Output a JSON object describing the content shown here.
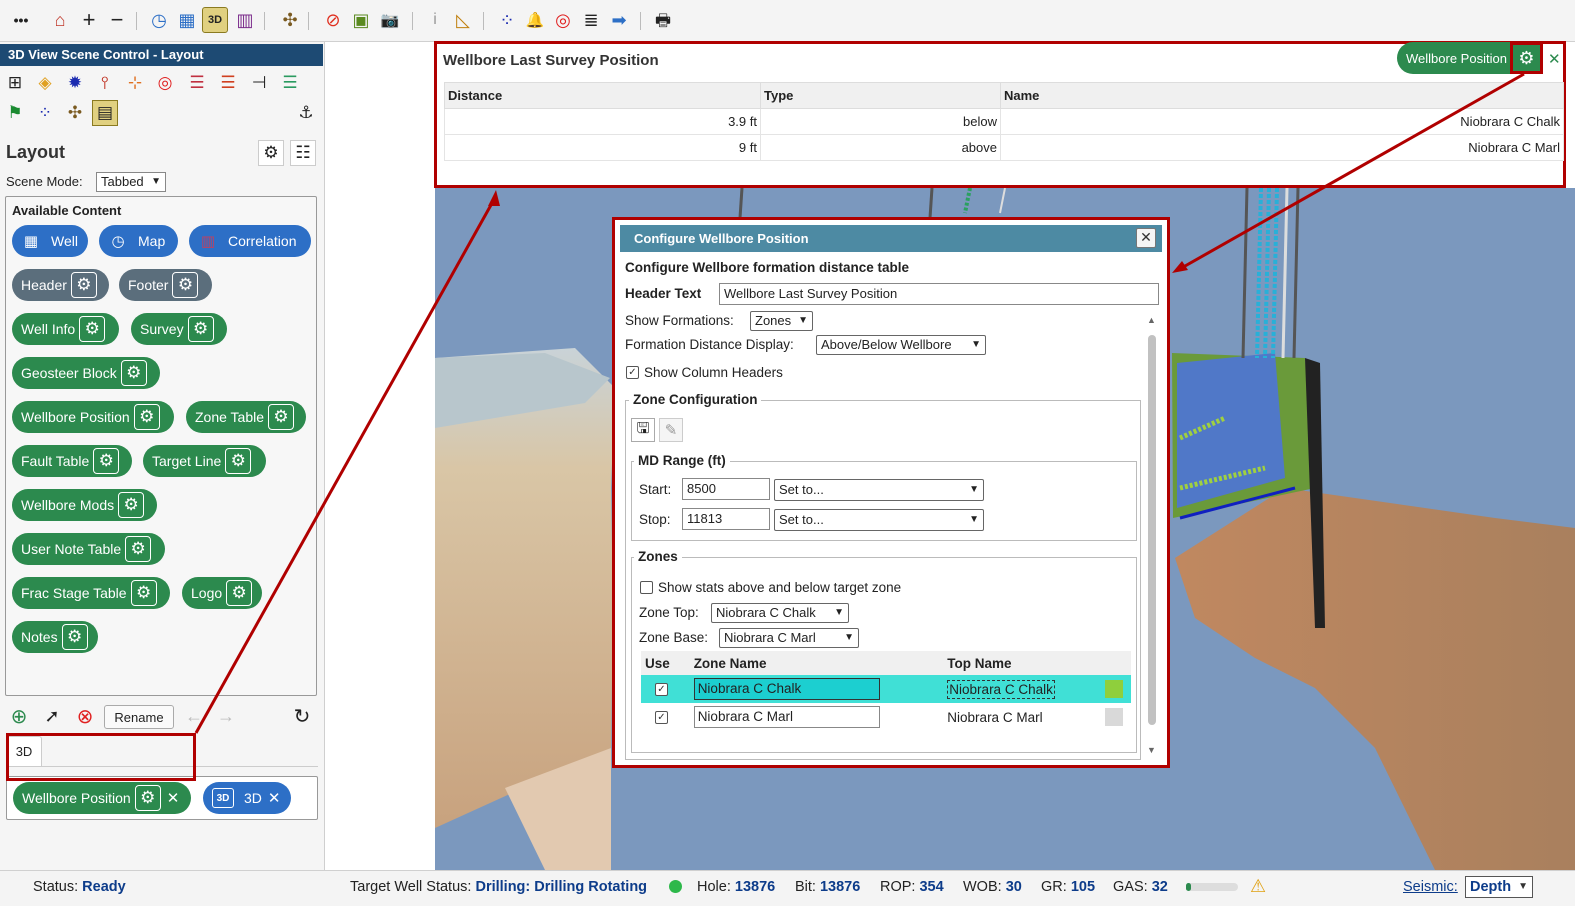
{
  "toolbar": {
    "icons": [
      "more-icon",
      "home-icon",
      "zoom-in-icon",
      "zoom-out-icon",
      "compass-icon",
      "grid-icon",
      "3d-view-icon",
      "correlation-icon",
      "fault-icon",
      "no-entry-icon",
      "cube-icon",
      "camera-icon",
      "info-icon",
      "ruler-icon",
      "points-icon",
      "bell-icon",
      "target-icon",
      "layers-icon",
      "arrow-right-icon",
      "print-icon"
    ],
    "glyphs": [
      "•••",
      "⌂",
      "+",
      "−",
      "◷",
      "▦",
      "3D",
      "▥",
      "✣",
      "⊘",
      "▣",
      "📷",
      "i",
      "◺",
      "⁘",
      "🔔",
      "◎",
      "≣",
      "➡",
      "🖶"
    ]
  },
  "left_panel": {
    "title": "3D View Scene Control - Layout",
    "layout_title": "Layout",
    "scene_mode_label": "Scene Mode:",
    "scene_mode_value": "Tabbed",
    "available_title": "Available Content",
    "chips": {
      "well": "Well",
      "map": "Map",
      "correlation": "Correlation",
      "header": "Header",
      "footer": "Footer",
      "well_info": "Well Info",
      "survey": "Survey",
      "geosteer_block": "Geosteer Block",
      "wellbore_position": "Wellbore Position",
      "zone_table": "Zone Table",
      "fault_table": "Fault Table",
      "target_line": "Target Line",
      "wellbore_mods": "Wellbore Mods",
      "user_note_table": "User Note Table",
      "frac_stage_table": "Frac Stage Table",
      "logo": "Logo",
      "notes": "Notes"
    },
    "rename_label": "Rename",
    "tab_label": "3D",
    "active": {
      "wellbore_position": "Wellbore Position",
      "threed": "3D",
      "threed_icon": "3D"
    }
  },
  "survey_panel": {
    "title": "Wellbore Last Survey Position",
    "columns": [
      "Distance",
      "Type",
      "Name"
    ],
    "rows": [
      {
        "distance": "3.9 ft",
        "type": "below",
        "name": "Niobrara C Chalk"
      },
      {
        "distance": "9 ft",
        "type": "above",
        "name": "Niobrara C Marl"
      }
    ],
    "badge_label": "Wellbore Position"
  },
  "dialog": {
    "title": "Configure Wellbore Position",
    "subtitle": "Configure Wellbore formation distance table",
    "header_text_label": "Header Text",
    "header_text_value": "Wellbore Last Survey Position",
    "show_formations_label": "Show Formations:",
    "show_formations_value": "Zones",
    "formation_distance_label": "Formation Distance Display:",
    "formation_distance_value": "Above/Below Wellbore",
    "show_column_headers_label": "Show Column Headers",
    "zone_config_legend": "Zone Configuration",
    "md_range_legend": "MD Range (ft)",
    "start_label": "Start:",
    "start_value": "8500",
    "start_select": "Set to...",
    "stop_label": "Stop:",
    "stop_value": "11813",
    "stop_select": "Set to...",
    "zones_legend": "Zones",
    "show_stats_label": "Show stats above and below target zone",
    "zone_top_label": "Zone Top:",
    "zone_top_value": "Niobrara C Chalk",
    "zone_base_label": "Zone Base:",
    "zone_base_value": "Niobrara C Marl",
    "table_columns": [
      "Use",
      "Zone Name",
      "Top Name"
    ],
    "zone_rows": [
      {
        "zone_name": "Niobrara C Chalk",
        "top_name": "Niobrara C Chalk",
        "color": "#8fcf3c"
      },
      {
        "zone_name": "Niobrara C Marl",
        "top_name": "Niobrara C Marl",
        "color": "#d9d9d9"
      }
    ]
  },
  "status_bar": {
    "status_label": "Status:",
    "status_value": "Ready",
    "target_label": "Target Well Status:",
    "target_value": "Drilling: Drilling Rotating",
    "hole_label": "Hole:",
    "hole_value": "13876",
    "bit_label": "Bit:",
    "bit_value": "13876",
    "rop_label": "ROP:",
    "rop_value": "354",
    "wob_label": "WOB:",
    "wob_value": "30",
    "gr_label": "GR:",
    "gr_value": "105",
    "gas_label": "GAS:",
    "gas_value": "32",
    "seismic_label": "Seismic:",
    "seismic_value": "Depth"
  },
  "colors": {
    "accent_green": "#2c8a4e",
    "accent_blue": "#2d6fc6",
    "highlight_red": "#b00000",
    "status_blue": "#0d3c8a"
  }
}
